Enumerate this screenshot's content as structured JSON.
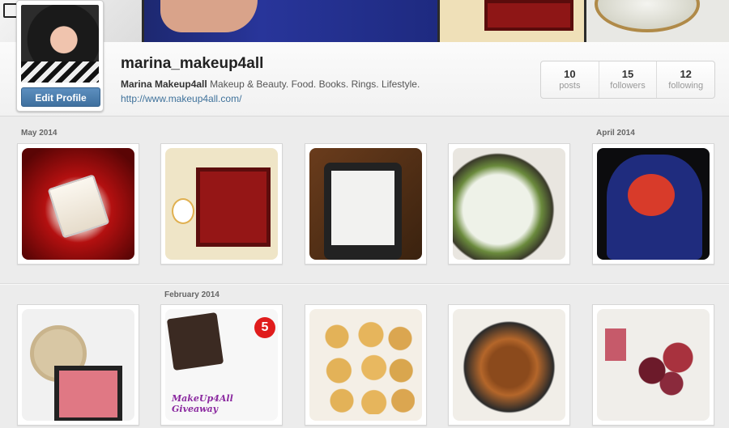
{
  "profile": {
    "username": "marina_makeup4all",
    "full_name": "Marina Makeup4all",
    "bio": "Makeup & Beauty. Food. Books. Rings. Lifestyle.",
    "website": "http://www.makeup4all.com/",
    "edit_button": "Edit Profile"
  },
  "stats": [
    {
      "value": "10",
      "label": "posts"
    },
    {
      "value": "15",
      "label": "followers"
    },
    {
      "value": "12",
      "label": "following"
    }
  ],
  "feed": {
    "months": [
      "May 2014",
      "April 2014",
      "February 2014"
    ],
    "giveaway_caption": "MakeUp4All Giveaway",
    "giveaway_number": "5"
  }
}
